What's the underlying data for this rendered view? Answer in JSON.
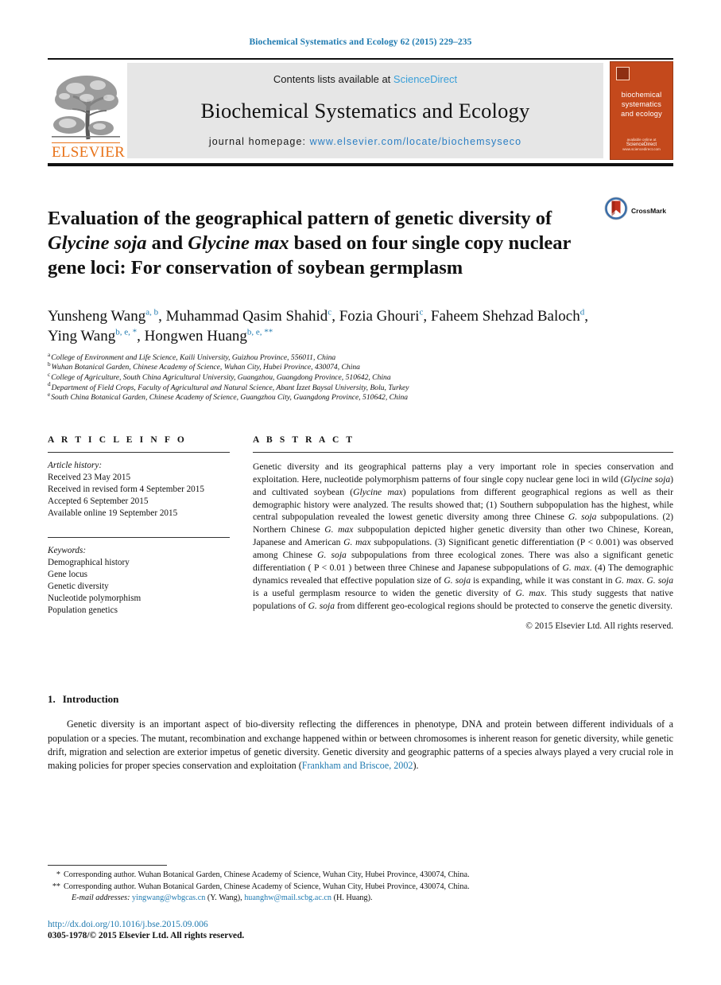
{
  "running_head": "Biochemical Systematics and Ecology 62 (2015) 229–235",
  "masthead": {
    "contents_prefix": "Contents lists available at ",
    "sciencedirect": "ScienceDirect",
    "journal_name": "Biochemical Systematics and Ecology",
    "homepage_prefix": "journal homepage: ",
    "homepage_url": "www.elsevier.com/locate/biochemsyseco",
    "publisher": "ELSEVIER",
    "cover_title": "biochemical\nsystematics\nand ecology",
    "cover_line1": "biochemical",
    "cover_line2": "systematics",
    "cover_line3": "and ecology",
    "cover_footer_small": "available online at",
    "cover_footer_brand": "ScienceDirect",
    "cover_footer_url": "www.sciencedirect.com",
    "accent_orange": "#c4491c",
    "link_blue": "#3a9fd8",
    "elsevier_orange": "#e8731a"
  },
  "article": {
    "title_line1": "Evaluation of the geographical pattern of genetic diversity of",
    "title_italic1": "Glycine soja",
    "title_mid": " and ",
    "title_italic2": "Glycine max",
    "title_line2_rest": " based on four single copy nuclear",
    "title_line3": "gene loci: For conservation of soybean germplasm",
    "crossmark_label": "CrossMark"
  },
  "authors": {
    "list": [
      {
        "name": "Yunsheng Wang",
        "sup": "a, b",
        "sep": ","
      },
      {
        "name": "Muhammad Qasim Shahid",
        "sup": "c",
        "sep": ","
      },
      {
        "name": "Fozia Ghouri",
        "sup": "c",
        "sep": ","
      },
      {
        "name": "Faheem Shehzad Baloch",
        "sup": "d",
        "sep": ","
      },
      {
        "name": "Ying Wang",
        "sup": "b, e, *",
        "sep": ","
      },
      {
        "name": "Hongwen Huang",
        "sup": "b, e, **",
        "sep": ""
      }
    ],
    "affiliations": [
      {
        "mark": "a",
        "text": "College of Environment and Life Science, Kaili University, Guizhou Province, 556011, China"
      },
      {
        "mark": "b",
        "text": "Wuhan Botanical Garden, Chinese Academy of Science, Wuhan City, Hubei Province, 430074, China"
      },
      {
        "mark": "c",
        "text": "College of Agriculture, South China Agricultural University, Guangzhou, Guangdong Province, 510642, China"
      },
      {
        "mark": "d",
        "text": "Department of Field Crops, Faculty of Agricultural and Natural Science, Abant İzzet Baysal University, Bolu, Turkey"
      },
      {
        "mark": "e",
        "text": "South China Botanical Garden, Chinese Academy of Science, Guangzhou City, Guangdong Province, 510642, China"
      }
    ]
  },
  "article_info": {
    "heading": "A R T I C L E  I N F O",
    "history_label": "Article history:",
    "history": [
      "Received 23 May 2015",
      "Received in revised form 4 September 2015",
      "Accepted 6 September 2015",
      "Available online 19 September 2015"
    ],
    "keywords_label": "Keywords:",
    "keywords": [
      "Demographical history",
      "Gene locus",
      "Genetic diversity",
      "Nucleotide polymorphism",
      "Population genetics"
    ]
  },
  "abstract": {
    "heading": "A B S T R A C T",
    "p1": "Genetic diversity and its geographical patterns play a very important role in species conservation and exploitation. Here, nucleotide polymorphism patterns of four single copy nuclear gene loci in wild (",
    "sp1": "Glycine soja",
    "p2": ") and cultivated soybean (",
    "sp2": "Glycine max",
    "p3": ") populations from different geographical regions as well as their demographic history were analyzed. The results showed that; (1) Southern subpopulation has the highest, while central subpopulation revealed the lowest genetic diversity among three Chinese ",
    "sp3": "G. soja",
    "p4": " subpopulations. (2) Northern Chinese ",
    "sp4": "G. max",
    "p5": " subpopulation depicted higher genetic diversity than other two Chinese, Korean, Japanese and American ",
    "sp5": "G. max",
    "p6": " subpopulations. (3) Significant genetic differentiation (P < 0.001) was observed among Chinese ",
    "sp6": "G. soja",
    "p7": " subpopulations from three ecological zones. There was also a significant genetic differentiation ( P < 0.01 ) between three Chinese and Japanese subpopulations of ",
    "sp7": "G. max",
    "p8": ". (4) The demographic dynamics revealed that effective population size of ",
    "sp8": "G. soja",
    "p9": " is expanding, while it was constant in ",
    "sp9": "G. max",
    "p10": ". ",
    "sp10": "G. soja",
    "p11": " is a useful germplasm resource to widen the genetic diversity of ",
    "sp11": "G. max",
    "p12": ". This study suggests that native populations of ",
    "sp12": "G. soja",
    "p13": " from different geo-ecological regions should be protected to conserve the genetic diversity.",
    "copyright": "© 2015 Elsevier Ltd. All rights reserved."
  },
  "introduction": {
    "number": "1.",
    "heading": "Introduction",
    "p1": "Genetic diversity is an important aspect of bio-diversity reflecting the differences in phenotype, DNA and protein between different individuals of a population or a species. The mutant, recombination and exchange happened within or between chromosomes is inherent reason for genetic diversity, while genetic drift, migration and selection are exterior impetus of genetic diversity. Genetic diversity and geographic patterns of a species always played a very crucial role in making policies for proper species conservation and exploitation (",
    "citation": "Frankham and Briscoe, 2002",
    "p1_end": ")."
  },
  "footnotes": {
    "corr1_mark": "*",
    "corr1": "Corresponding author. Wuhan Botanical Garden, Chinese Academy of Science, Wuhan City, Hubei Province, 430074, China.",
    "corr2_mark": "**",
    "corr2": "Corresponding author. Wuhan Botanical Garden, Chinese Academy of Science, Wuhan City, Hubei Province, 430074, China.",
    "email_label": "E-mail addresses:",
    "email1": "yingwang@wbgcas.cn",
    "email1_owner": " (Y. Wang), ",
    "email2": "huanghw@mail.scbg.ac.cn",
    "email2_owner": " (H. Huang).",
    "doi": "http://dx.doi.org/10.1016/j.bse.2015.09.006",
    "issn": "0305-1978/© 2015 Elsevier Ltd. All rights reserved."
  }
}
